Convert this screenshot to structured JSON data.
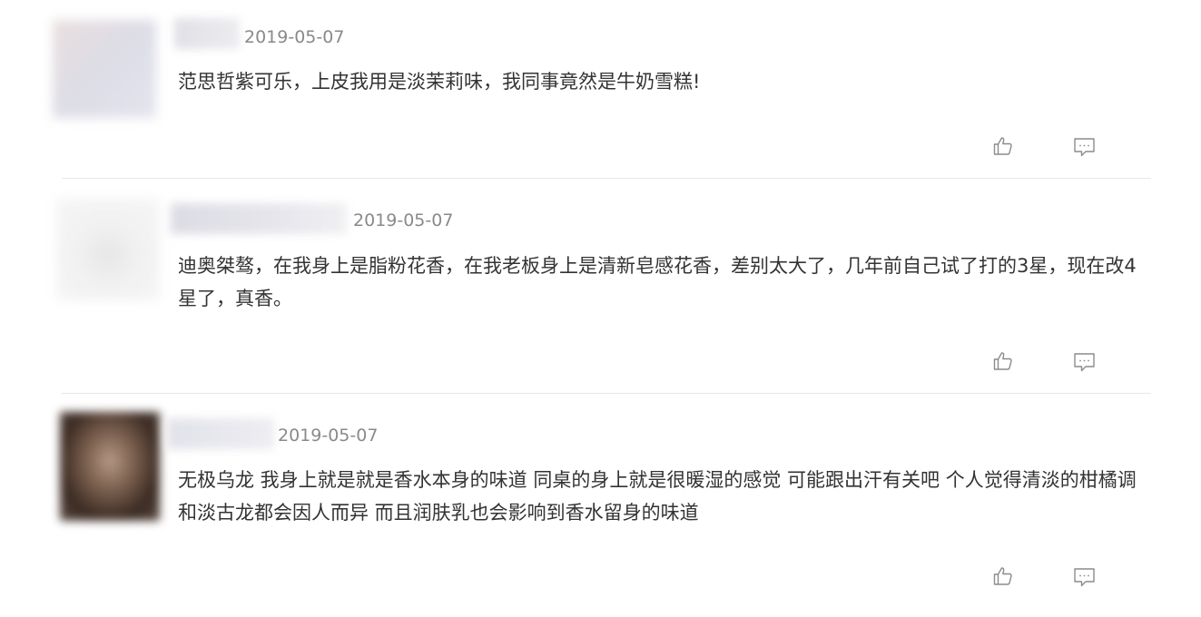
{
  "comments": [
    {
      "date": "2019-05-07",
      "text": "范思哲紫可乐，上皮我用是淡茉莉味，我同事竟然是牛奶雪糕!"
    },
    {
      "date": "2019-05-07",
      "text": "迪奥桀骜，在我身上是脂粉花香，在我老板身上是清新皂感花香，差别太大了，几年前自己试了打的3星，现在改4星了，真香。"
    },
    {
      "date": "2019-05-07",
      "text": "无极乌龙 我身上就是就是香水本身的味道 同桌的身上就是很暖湿的感觉 可能跟出汗有关吧 个人觉得清淡的柑橘调和淡古龙都会因人而异 而且润肤乳也会影响到香水留身的味道"
    }
  ],
  "icons": {
    "like": "thumbs-up-icon",
    "reply": "comment-bubble-icon"
  },
  "colors": {
    "text": "#333333",
    "date": "#8a8a8a",
    "icon": "#8c8c8c",
    "divider": "#e8e8e8"
  }
}
